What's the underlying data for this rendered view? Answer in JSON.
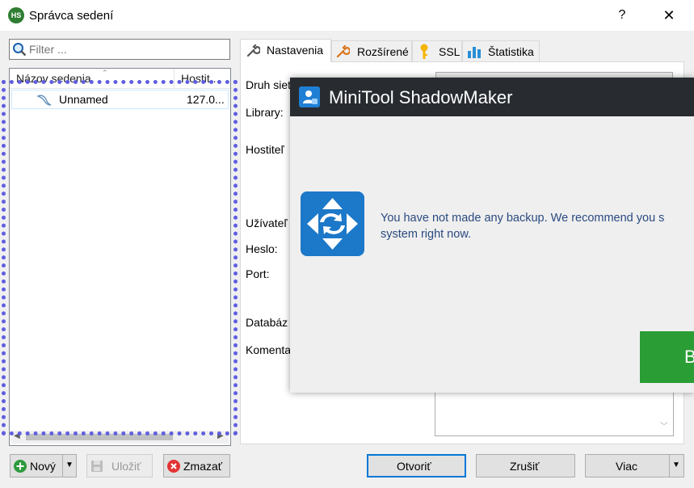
{
  "window": {
    "title": "Správca sedení",
    "app_icon_text": "HS",
    "help_label": "?",
    "close_label": "✕"
  },
  "filter": {
    "placeholder": "Filter ..."
  },
  "session_list": {
    "columns": [
      "Názov sedenia",
      "Hostit..."
    ],
    "sort_indicator": "⌃",
    "rows": [
      {
        "name": "Unnamed",
        "host": "127.0..."
      }
    ],
    "scroll_left": "◀",
    "scroll_right": "▶"
  },
  "tabs": [
    {
      "label": "Nastavenia",
      "icon": "wrench-icon",
      "active": true
    },
    {
      "label": "Rozšírené",
      "icon": "wrench-orange-icon",
      "active": false
    },
    {
      "label": "SSL",
      "icon": "key-icon",
      "active": false
    },
    {
      "label": "Štatistika",
      "icon": "bar-chart-icon",
      "active": false
    }
  ],
  "settings_fields": {
    "network_type": "Druh siet",
    "library": "Library:",
    "host": "Hostiteľ",
    "user": "Užívateľ",
    "password": "Heslo:",
    "port": "Port:",
    "database": "Databáz",
    "comment": "Komenta"
  },
  "popup": {
    "title": "MiniTool ShadowMaker",
    "message_line1": "You have not made any backup. We recommend you s",
    "message_line2": "system right now.",
    "button_label": "B",
    "button_color": "#2a9d35",
    "titlebar_color": "#282c31"
  },
  "buttons": {
    "new": "Nový",
    "save": "Uložiť",
    "delete": "Zmazať",
    "open": "Otvoriť",
    "cancel": "Zrušiť",
    "more": "Viac",
    "dropdown_arrow": "▼"
  },
  "colors": {
    "accent": "#0078d7",
    "selection_frame": "#5f5fe0"
  }
}
